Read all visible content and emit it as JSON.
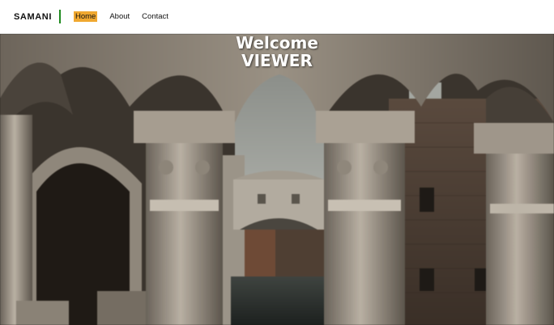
{
  "navbar": {
    "brand": "SAMANI",
    "links": [
      {
        "label": "Home",
        "active": true
      },
      {
        "label": "About",
        "active": false
      },
      {
        "label": "Contact",
        "active": false
      }
    ]
  },
  "hero": {
    "line1": "Welcome",
    "line2": "VIEWER",
    "image_subject": "stone arches framing a bridge over a canal"
  },
  "colors": {
    "accent_divider": "#1f8a1f",
    "active_link_bg": "#f0a830",
    "hero_text": "#ffffff"
  }
}
